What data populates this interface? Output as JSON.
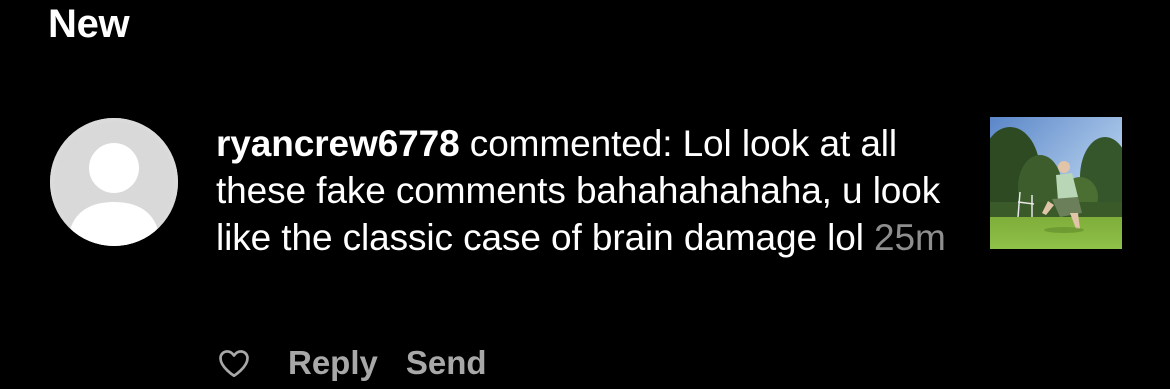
{
  "section": {
    "title": "New"
  },
  "notification": {
    "username": "ryancrew6778",
    "action": "commented:",
    "comment": "Lol look at all these fake comments bahahahahaha, u look like the classic case of brain damage lol",
    "timestamp": "25m",
    "avatar": "default-profile-avatar",
    "thumbnail": "post-photo-person-sitting-on-grass"
  },
  "actions": {
    "like_icon": "heart-outline-icon",
    "reply_label": "Reply",
    "send_label": "Send"
  },
  "colors": {
    "background": "#000000",
    "text": "#ffffff",
    "timestamp": "#8e8e8e",
    "action_text": "#a8a8a8",
    "avatar_bg": "#dbdbdb"
  }
}
